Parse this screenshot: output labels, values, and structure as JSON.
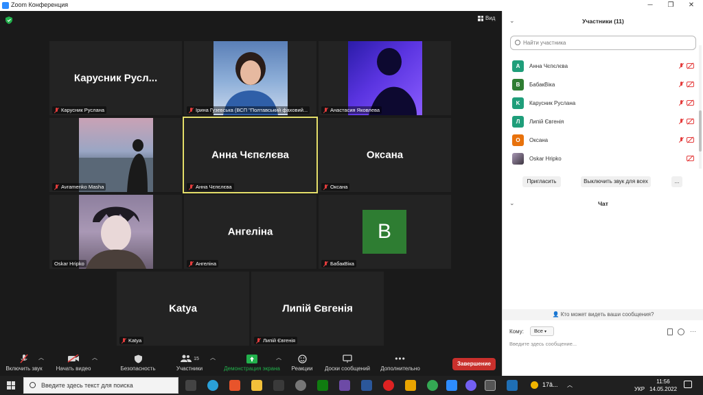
{
  "window": {
    "title": "Zoom Конференция"
  },
  "meeting": {
    "view_label": "Вид",
    "tiles": [
      {
        "id": "ruslana",
        "big": "Карусник  Русл...",
        "caption": "Карусник  Руслана",
        "muted": true
      },
      {
        "id": "iryna",
        "big": "",
        "caption": "Ірина Гузевська (ВСП \"Полтавський фаховий...",
        "muted": true
      },
      {
        "id": "anastasia",
        "big": "",
        "caption": "Анастасия Яковлева",
        "muted": true
      },
      {
        "id": "masha",
        "big": "",
        "caption": "Avramenko Masha",
        "muted": true
      },
      {
        "id": "anna",
        "big": "Анна Чєпєлєва",
        "caption": "Анна Чєпєлєва",
        "muted": true
      },
      {
        "id": "oksana",
        "big": "Оксана",
        "caption": "Оксана",
        "muted": true
      },
      {
        "id": "oskar",
        "big": "",
        "caption": "Oskar Hripko",
        "muted": false
      },
      {
        "id": "angelina",
        "big": "Ангеліна",
        "caption": "Ангеліна",
        "muted": true
      },
      {
        "id": "babak",
        "big": "B",
        "caption": "БабакВіка",
        "muted": true
      },
      {
        "id": "katya",
        "big": "Katya",
        "caption": "Katya",
        "muted": true
      },
      {
        "id": "lypiy",
        "big": "Липій Євгенія",
        "caption": "Липій Євгенія",
        "muted": true
      }
    ]
  },
  "toolbar": {
    "unmute": "Включить звук",
    "start_video": "Начать видео",
    "security": "Безопасность",
    "participants": "Участники",
    "participants_count": "15",
    "share": "Демонстрация экрана",
    "reactions": "Реакции",
    "whiteboard": "Доски сообщений",
    "more": "Дополнительно",
    "end": "Завершение"
  },
  "panel": {
    "participants_title": "Участники (11)",
    "search_placeholder": "Найти участника",
    "participants": [
      {
        "initial": "A",
        "name": "Анна Чєпєлєва",
        "color": "#1f9e7a"
      },
      {
        "initial": "B",
        "name": "БабакВіка",
        "color": "#2e7d32"
      },
      {
        "initial": "K",
        "name": "Карусник  Руслана",
        "color": "#1f9e7a"
      },
      {
        "initial": "Л",
        "name": "Липій Євгенія",
        "color": "#1f9e7a"
      },
      {
        "initial": "O",
        "name": "Оксана",
        "color": "#e8720c"
      },
      {
        "initial": "",
        "name": "Oskar Hripko",
        "color": "#555555"
      }
    ],
    "invite": "Пригласить",
    "mute_all": "Выключить звук для всех",
    "more": "...",
    "chat_title": "Чат",
    "who_sees": "Кто может видеть ваши сообщения?",
    "to_label": "Кому:",
    "to_value": "Все",
    "input_placeholder": "Введите здесь сообщение..."
  },
  "taskbar": {
    "search_placeholder": "Введите здесь текст для поиска",
    "weather": "17â...",
    "lang": "УКР",
    "time": "11:56",
    "date": "14.05.2022"
  },
  "colors": {
    "accent_green": "#22b14c",
    "end_red": "#c9302c",
    "active_border": "#e6e06a"
  }
}
